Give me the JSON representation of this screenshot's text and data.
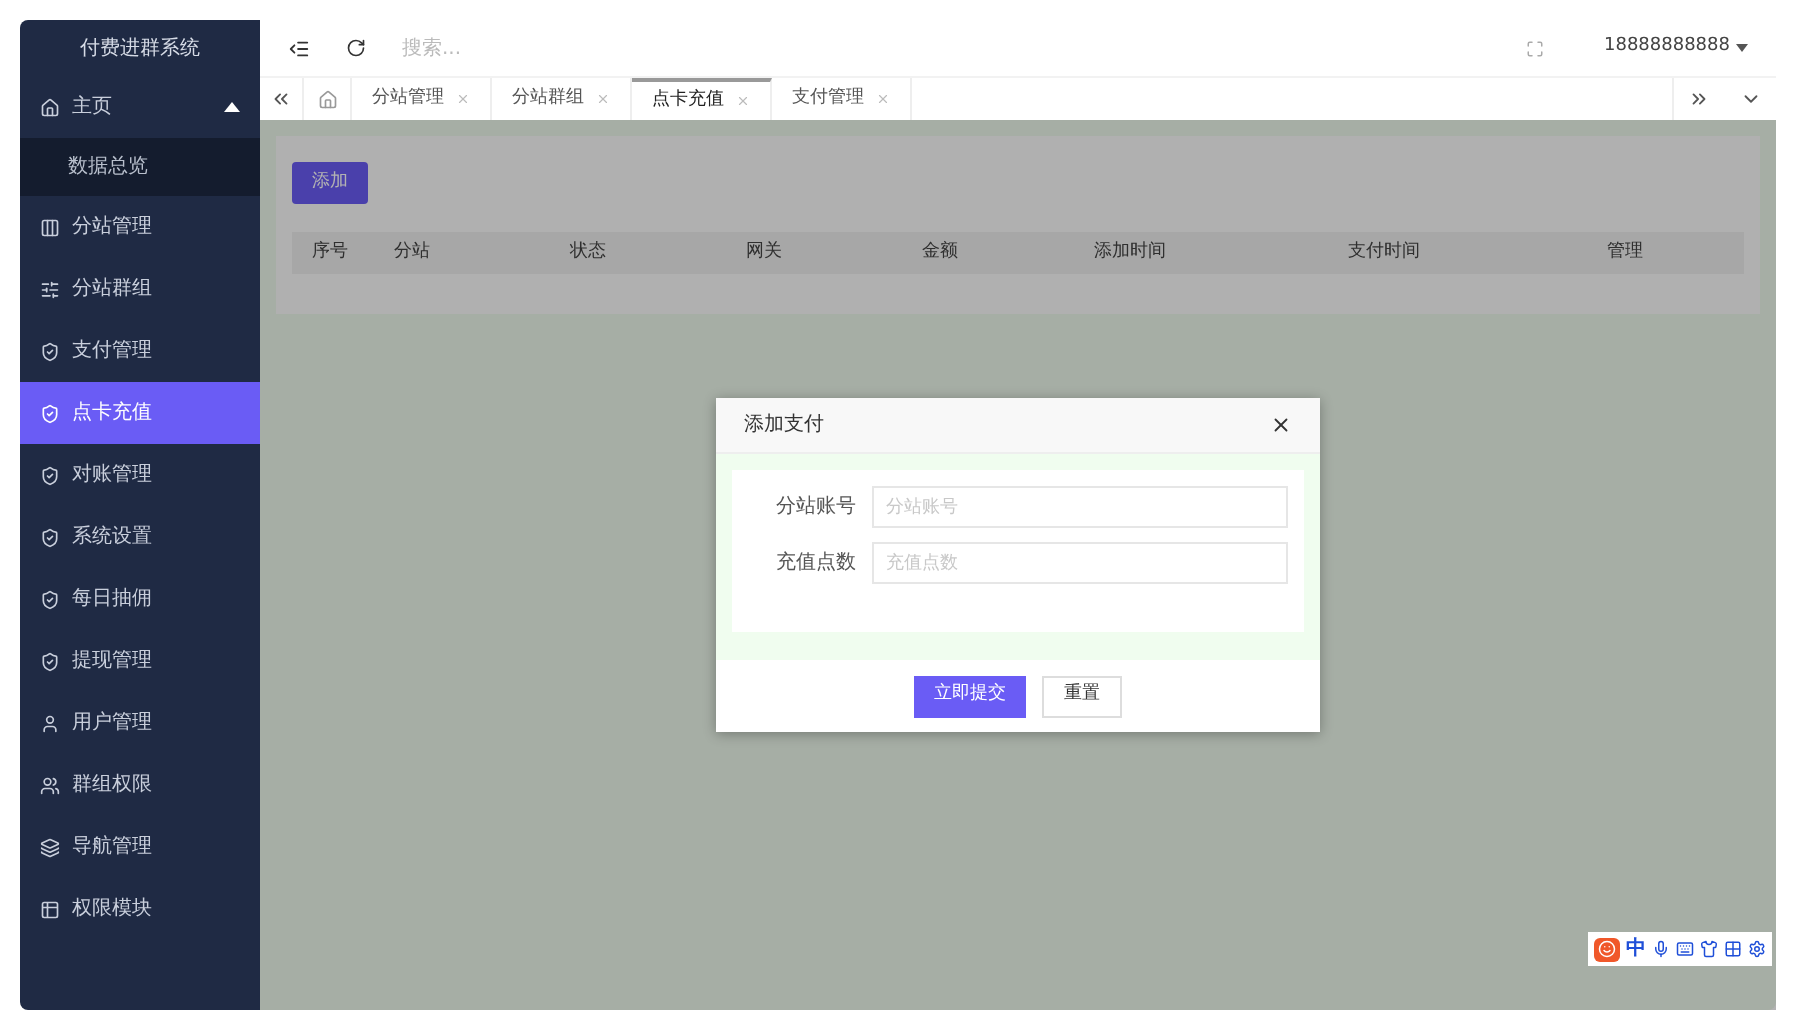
{
  "app": {
    "title": "付费进群系统"
  },
  "sidebar": {
    "items": [
      {
        "label": "主页",
        "selected": false,
        "expanded": true,
        "children": [
          {
            "label": "数据总览",
            "selected": false
          }
        ]
      },
      {
        "label": "分站管理",
        "selected": false
      },
      {
        "label": "分站群组",
        "selected": false
      },
      {
        "label": "支付管理",
        "selected": false
      },
      {
        "label": "点卡充值",
        "selected": true
      },
      {
        "label": "对账管理",
        "selected": false
      },
      {
        "label": "系统设置",
        "selected": false
      },
      {
        "label": "每日抽佣",
        "selected": false
      },
      {
        "label": "提现管理",
        "selected": false
      },
      {
        "label": "用户管理",
        "selected": false
      },
      {
        "label": "群组权限",
        "selected": false
      },
      {
        "label": "导航管理",
        "selected": false
      },
      {
        "label": "权限模块",
        "selected": false
      }
    ]
  },
  "header": {
    "search": {
      "placeholder": "搜索..."
    },
    "user": "18888888888"
  },
  "tabs": [
    {
      "label": "分站管理",
      "selected": false
    },
    {
      "label": "分站群组",
      "selected": false
    },
    {
      "label": "点卡充值",
      "selected": true
    },
    {
      "label": "支付管理",
      "selected": false
    }
  ],
  "content": {
    "add_button": "添加",
    "table": {
      "columns": [
        "序号",
        "分站",
        "状态",
        "网关",
        "金额",
        "添加时间",
        "支付时间",
        "管理"
      ]
    }
  },
  "dialog": {
    "title": "添加支付",
    "fields": [
      {
        "label": "分站账号",
        "placeholder": "分站账号"
      },
      {
        "label": "充值点数",
        "placeholder": "充值点数"
      }
    ],
    "buttons": [
      {
        "label": "立即提交",
        "kind": "primary"
      },
      {
        "label": "重置",
        "kind": "default"
      }
    ]
  },
  "ime": {
    "mode": "中"
  }
}
